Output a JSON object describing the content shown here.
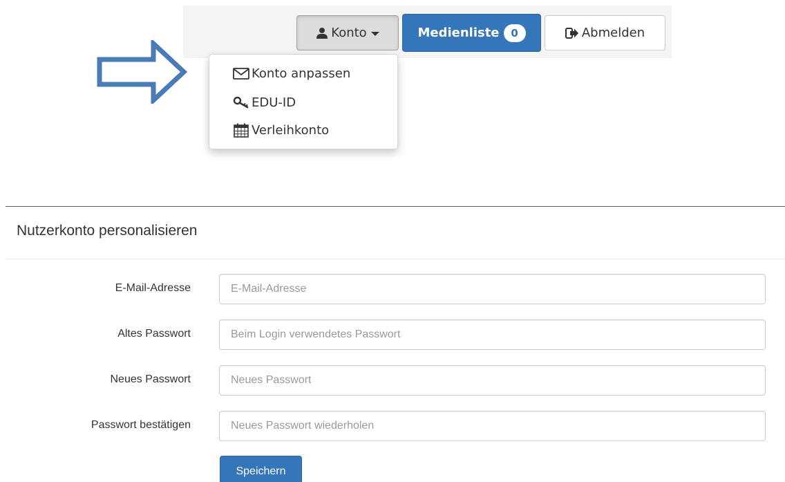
{
  "nav": {
    "account_label": "Konto",
    "media_list_label": "Medienliste",
    "media_list_count": "0",
    "logout_label": "Abmelden",
    "icons": {
      "account": "user-icon",
      "account_caret": "caret-down-icon",
      "logout": "sign-out-icon"
    }
  },
  "dropdown": {
    "items": [
      {
        "label": "Konto anpassen",
        "icon": "envelope-icon"
      },
      {
        "label": "EDU-ID",
        "icon": "key-icon"
      },
      {
        "label": "Verleihkonto",
        "icon": "calendar-icon"
      }
    ]
  },
  "annotation": {
    "arrow_icon": "arrow-right-outline",
    "arrow_color": "#4a7bb7"
  },
  "form": {
    "title": "Nutzerkonto personalisieren",
    "fields": [
      {
        "label": "E-Mail-Adresse",
        "placeholder": "E-Mail-Adresse",
        "value": ""
      },
      {
        "label": "Altes Passwort",
        "placeholder": "Beim Login verwendetes Passwort",
        "value": ""
      },
      {
        "label": "Neues Passwort",
        "placeholder": "Neues Passwort",
        "value": ""
      },
      {
        "label": "Passwort bestätigen",
        "placeholder": "Neues Passwort wiederholen",
        "value": ""
      }
    ],
    "submit_label": "Speichern"
  },
  "colors": {
    "primary": "#3576bb",
    "primary_border": "#2d66a4",
    "default_button_bg": "#ffffff",
    "active_button_bg": "#dcdcdc",
    "text": "#333333",
    "placeholder": "#9a9a9a"
  }
}
